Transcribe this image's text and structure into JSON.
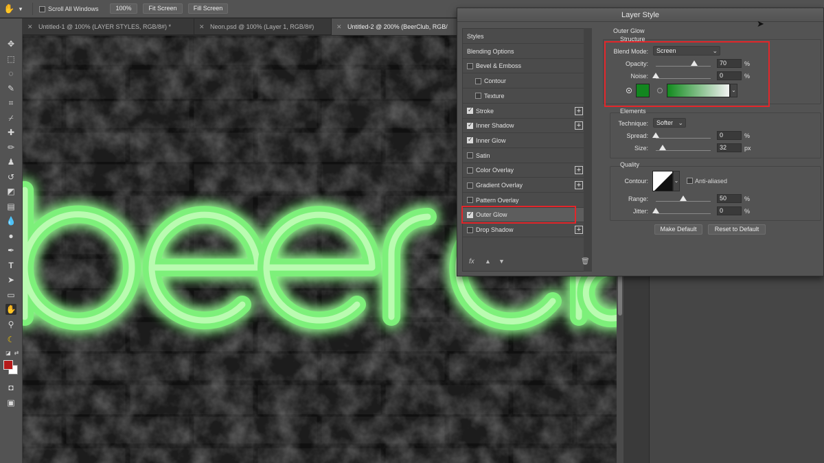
{
  "options_bar": {
    "scroll_all_windows": "Scroll All Windows",
    "zoom": "100%",
    "fit_screen": "Fit Screen",
    "fill_screen": "Fill Screen"
  },
  "tabs": [
    {
      "label": "Untitled-1 @ 100% (LAYER STYLES, RGB/8#) *"
    },
    {
      "label": "Neon.psd @ 100% (Layer 1, RGB/8#)"
    },
    {
      "label": "Untitled-2 @ 200% (BeerClub, RGB/"
    }
  ],
  "canvas": {
    "text": "beerclu",
    "glow_color": "#7df07a",
    "stroke_color": "#b9fbb0"
  },
  "dialog": {
    "title": "Layer Style",
    "list": [
      {
        "label": "Styles",
        "checkbox": false,
        "checked": false,
        "plus": false,
        "indent": 0,
        "selected": false
      },
      {
        "label": "Blending Options",
        "checkbox": false,
        "checked": false,
        "plus": false,
        "indent": 0,
        "selected": false
      },
      {
        "label": "Bevel & Emboss",
        "checkbox": true,
        "checked": false,
        "plus": false,
        "indent": 0,
        "selected": false
      },
      {
        "label": "Contour",
        "checkbox": true,
        "checked": false,
        "plus": false,
        "indent": 1,
        "selected": false
      },
      {
        "label": "Texture",
        "checkbox": true,
        "checked": false,
        "plus": false,
        "indent": 1,
        "selected": false
      },
      {
        "label": "Stroke",
        "checkbox": true,
        "checked": true,
        "plus": true,
        "indent": 0,
        "selected": false
      },
      {
        "label": "Inner Shadow",
        "checkbox": true,
        "checked": true,
        "plus": true,
        "indent": 0,
        "selected": false
      },
      {
        "label": "Inner Glow",
        "checkbox": true,
        "checked": true,
        "plus": false,
        "indent": 0,
        "selected": false
      },
      {
        "label": "Satin",
        "checkbox": true,
        "checked": false,
        "plus": false,
        "indent": 0,
        "selected": false
      },
      {
        "label": "Color Overlay",
        "checkbox": true,
        "checked": false,
        "plus": true,
        "indent": 0,
        "selected": false
      },
      {
        "label": "Gradient Overlay",
        "checkbox": true,
        "checked": false,
        "plus": true,
        "indent": 0,
        "selected": false
      },
      {
        "label": "Pattern Overlay",
        "checkbox": true,
        "checked": false,
        "plus": false,
        "indent": 0,
        "selected": false
      },
      {
        "label": "Outer Glow",
        "checkbox": true,
        "checked": true,
        "plus": false,
        "indent": 0,
        "selected": true
      },
      {
        "label": "Drop Shadow",
        "checkbox": true,
        "checked": false,
        "plus": true,
        "indent": 0,
        "selected": false
      }
    ],
    "list_footer": {
      "fx": "fx",
      "up": "▲",
      "down": "▼",
      "trash": "🗑"
    },
    "outer_glow": {
      "heading": "Outer Glow",
      "structure": {
        "title": "Structure",
        "blend_mode_label": "Blend Mode:",
        "blend_mode": "Screen",
        "opacity_label": "Opacity:",
        "opacity": "70",
        "opacity_unit": "%",
        "opacity_fraction": 0.7,
        "noise_label": "Noise:",
        "noise": "0",
        "noise_unit": "%",
        "noise_fraction": 0,
        "swatch_color": "#12861f",
        "gradient_from": "#128b1e",
        "gradient_to": "#f2f2f2"
      },
      "elements": {
        "title": "Elements",
        "technique_label": "Technique:",
        "technique": "Softer",
        "spread_label": "Spread:",
        "spread": "0",
        "spread_unit": "%",
        "spread_fraction": 0,
        "size_label": "Size:",
        "size": "32",
        "size_unit": "px",
        "size_fraction": 0.13
      },
      "quality": {
        "title": "Quality",
        "contour_label": "Contour:",
        "anti_aliased": "Anti-aliased",
        "range_label": "Range:",
        "range": "50",
        "range_unit": "%",
        "range_fraction": 0.5,
        "jitter_label": "Jitter:",
        "jitter": "0",
        "jitter_unit": "%",
        "jitter_fraction": 0
      },
      "make_default": "Make Default",
      "reset_default": "Reset to Default"
    },
    "highlight_color": "#e3262a"
  },
  "colors": {
    "foreground": "#b51a1a",
    "background": "#ffffff"
  }
}
